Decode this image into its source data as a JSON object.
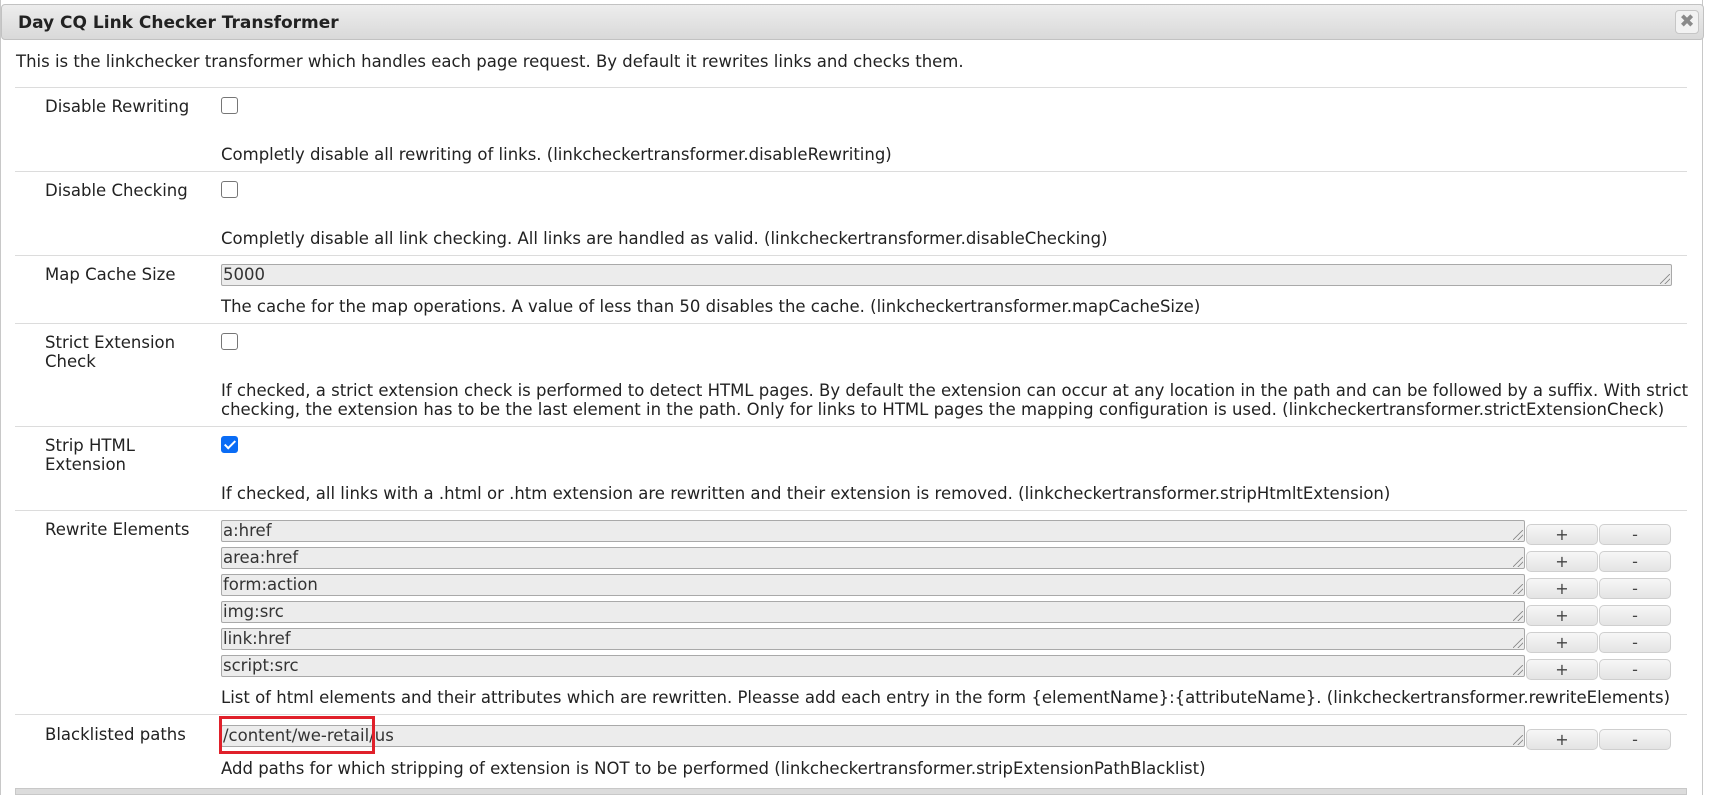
{
  "dialog": {
    "title": "Day CQ Link Checker Transformer",
    "close_icon": "close-icon",
    "description": "This is the linkchecker transformer which handles each page request. By default it rewrites links and checks them."
  },
  "fields": {
    "disable_rewriting": {
      "label": "Disable Rewriting",
      "checked": false,
      "help": "Completly disable all rewriting of links. (linkcheckertransformer.disableRewriting)"
    },
    "disable_checking": {
      "label": "Disable Checking",
      "checked": false,
      "help": "Completly disable all link checking. All links are handled as valid. (linkcheckertransformer.disableChecking)"
    },
    "map_cache_size": {
      "label": "Map Cache Size",
      "value": "5000",
      "help": "The cache for the map operations. A value of less than 50 disables the cache. (linkcheckertransformer.mapCacheSize)"
    },
    "strict_extension_check": {
      "label_line1": "Strict Extension",
      "label_line2": "Check",
      "checked": false,
      "help_line1": "If checked, a strict extension check is performed to detect HTML pages. By default the extension can occur at any location in the path and can be followed by a suffix. With strict",
      "help_line2": "checking, the extension has to be the last element in the path. Only for links to HTML pages the mapping configuration is used. (linkcheckertransformer.strictExtensionCheck)"
    },
    "strip_html_extension": {
      "label_line1": "Strip HTML",
      "label_line2": "Extension",
      "checked": true,
      "help": "If checked, all links with a .html or .htm extension are rewritten and their extension is removed. (linkcheckertransformer.stripHtmltExtension)"
    },
    "rewrite_elements": {
      "label": "Rewrite Elements",
      "values": [
        "a:href",
        "area:href",
        "form:action",
        "img:src",
        "link:href",
        "script:src"
      ],
      "add_label": "+",
      "remove_label": "-",
      "help": "List of html elements and their attributes which are rewritten. Pleasse add each entry in the form {elementName}:{attributeName}. (linkcheckertransformer.rewriteElements)"
    },
    "blacklisted_paths": {
      "label": "Blacklisted paths",
      "value": "/content/we-retail/us",
      "add_label": "+",
      "remove_label": "-",
      "help": "Add paths for which stripping of extension is NOT to be performed (linkcheckertransformer.stripExtensionPathBlacklist)"
    }
  },
  "colors": {
    "highlight_border": "#e0202a",
    "checkbox_checked": "#0a6cf5"
  }
}
